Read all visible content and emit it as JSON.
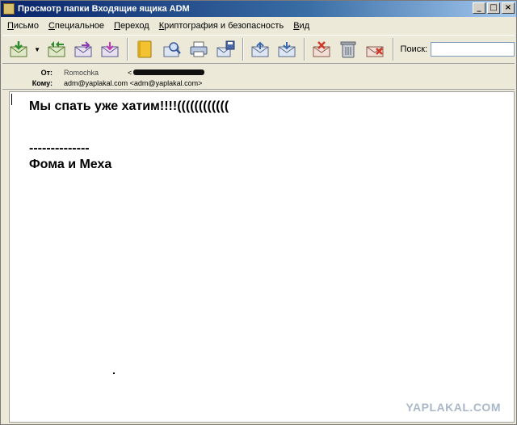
{
  "window": {
    "title": "Просмотр папки Входящие ящика ADM",
    "controls": {
      "minimize": "_",
      "maximize": "□",
      "close": "×"
    }
  },
  "menubar": {
    "items": [
      {
        "label": "Письмо",
        "underline": "П",
        "rest": "исьмо"
      },
      {
        "label": "Специальное",
        "underline": "С",
        "rest": "пециальное"
      },
      {
        "label": "Переход",
        "underline": "П",
        "rest": "ереход"
      },
      {
        "label": "Криптография и безопасность",
        "underline": "К",
        "rest": "риптография и безопасность"
      },
      {
        "label": "Вид",
        "underline": "В",
        "rest": "ид"
      }
    ]
  },
  "toolbar": {
    "buttons": [
      {
        "name": "download-mail-icon"
      },
      {
        "name": "reply-all-icon"
      },
      {
        "name": "forward-icon"
      },
      {
        "name": "send-icon"
      },
      {
        "name": "address-book-icon"
      },
      {
        "name": "search-mail-icon"
      },
      {
        "name": "print-icon"
      },
      {
        "name": "save-icon"
      },
      {
        "name": "previous-message-icon"
      },
      {
        "name": "next-message-icon"
      },
      {
        "name": "mark-spam-icon"
      },
      {
        "name": "trash-icon"
      },
      {
        "name": "delete-message-icon"
      }
    ],
    "search_label": "Поиск:",
    "search_value": ""
  },
  "headers": {
    "from_label": "От:",
    "from_name": "Romochka",
    "from_email_prefix": "<",
    "to_label": "Кому:",
    "to_value": "adm@yaplakal.com <adm@yaplakal.com>"
  },
  "message": {
    "line1": "Мы спать уже хатим!!!!((((((((((((",
    "line2": "--------------",
    "line3": "Фома и Меха"
  },
  "watermark": "YAPLAKAL.COM",
  "colors": {
    "titlebar_start": "#0a246a",
    "titlebar_end": "#a6caf0",
    "chrome": "#ece9d8"
  }
}
